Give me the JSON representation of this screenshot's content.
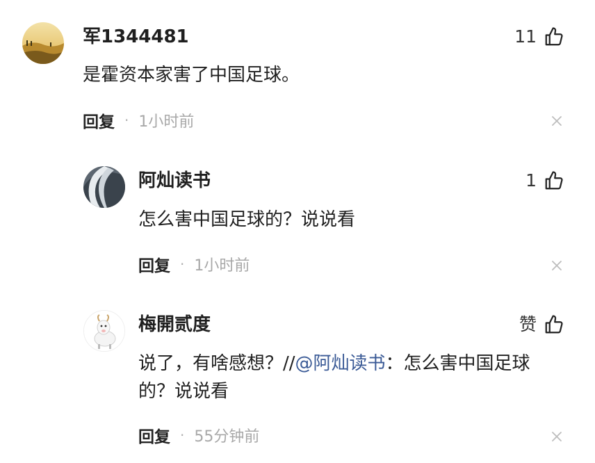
{
  "comments": [
    {
      "username": "军1344481",
      "likes": "11",
      "text": "是霍资本家害了中国足球。",
      "reply_label": "回复",
      "time": "1小时前",
      "avatar": "landscape-avatar"
    },
    {
      "username": "阿灿读书",
      "likes": "1",
      "text": "怎么害中国足球的？说说看",
      "reply_label": "回复",
      "time": "1小时前",
      "avatar": "wave-avatar"
    },
    {
      "username": "梅開贰度",
      "likes": "赞",
      "text_before": "说了，有啥感想？//",
      "mention": "@阿灿读书",
      "text_after": "：怎么害中国足球的？说说看",
      "reply_label": "回复",
      "time": "55分钟前",
      "avatar": "goat-avatar"
    }
  ],
  "icons": {
    "like": "thumbs-up-icon",
    "close": "close-icon"
  },
  "colors": {
    "mention": "#3a5a96",
    "time": "#a8a8a8",
    "text": "#1f1f1f"
  }
}
